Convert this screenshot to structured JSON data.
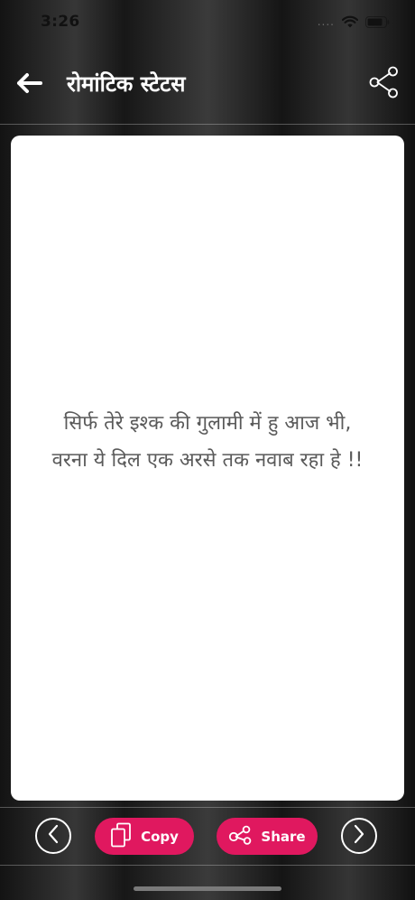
{
  "status_bar": {
    "time": "3:26",
    "signal": "...."
  },
  "header": {
    "title": "रोमांटिक स्टेटस"
  },
  "quote": {
    "lines": [
      "सिर्फ तेरे इश्क की गुलामी में हु आज भी,",
      "वरना ये दिल एक अरसे तक नवाब रहा हे !!"
    ]
  },
  "bottom_bar": {
    "copy_label": "Copy",
    "share_label": "Share"
  },
  "colors": {
    "accent": "#e0185f",
    "card": "#ffffff",
    "quote_text": "#5a5a5a"
  },
  "icons": {
    "back": "arrow-left-icon",
    "share": "share-icon",
    "copy": "copy-icon",
    "prev": "chevron-left-icon",
    "next": "chevron-right-icon",
    "wifi": "wifi-icon",
    "battery": "battery-icon"
  }
}
